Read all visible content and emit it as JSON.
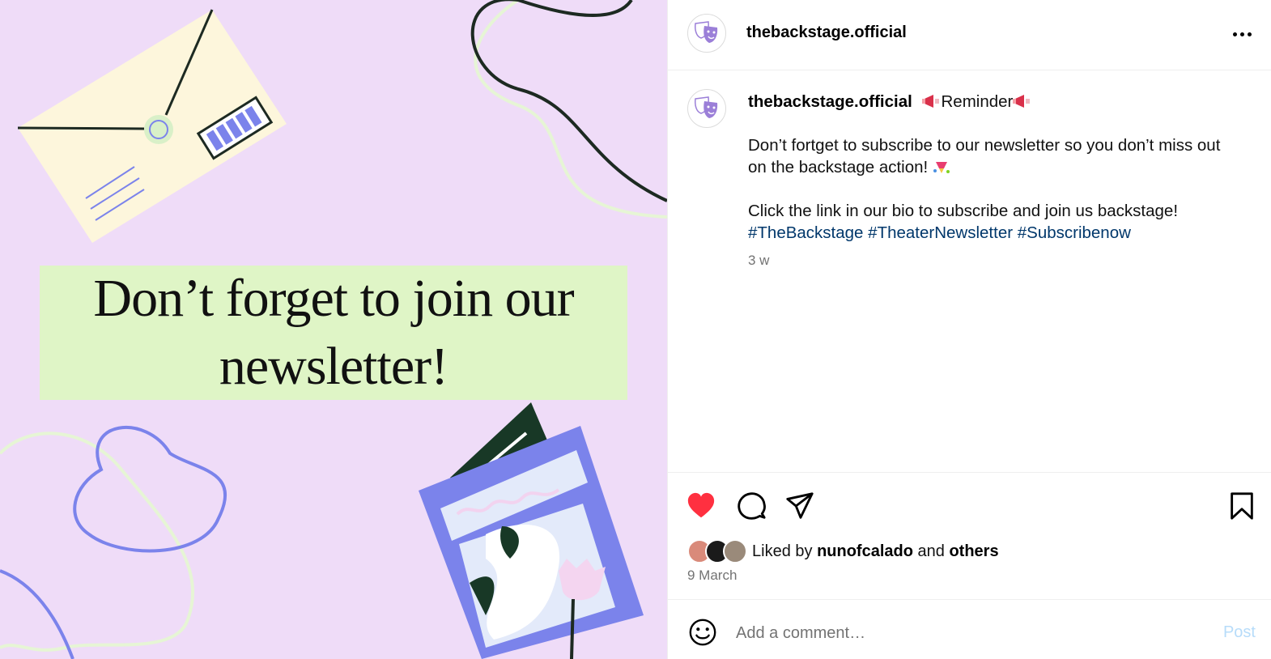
{
  "post": {
    "headline": "Don’t forget to join our newsletter!"
  },
  "header": {
    "username": "thebackstage.official",
    "avatar_icon": "theater-masks-icon",
    "more_icon": "more-options-icon"
  },
  "caption": {
    "username": "thebackstage.official",
    "title_word": "Reminder",
    "title_emoji": "megaphone-icon",
    "line1": "Don’t fortget to subscribe to our newsletter so you don’t miss out on the backstage action!",
    "line1_emoji": "confetti-icon",
    "line2": "Click the link in our bio to subscribe and join us backstage!",
    "hashtags": [
      "#TheBackstage",
      "#TheaterNewsletter",
      "#Subscribenow"
    ],
    "time_ago": "3 w"
  },
  "actions": {
    "like_icon": "heart-filled-icon",
    "comment_icon": "comment-icon",
    "share_icon": "paper-plane-icon",
    "save_icon": "bookmark-icon",
    "liked_by_prefix": "Liked by",
    "liked_by_user": "nunofcalado",
    "liked_by_and": "and",
    "liked_by_others": "others",
    "date": "9 March"
  },
  "comment": {
    "emoji_icon": "smiley-icon",
    "placeholder": "Add a comment…",
    "post_label": "Post"
  },
  "colors": {
    "image_bg": "#efdcf8",
    "headline_bg": "#dff5c6",
    "like_red": "#ff3040",
    "hashtag_blue": "#00376b",
    "post_disabled": "#b7dcfa",
    "accent_periwinkle": "#7b83eb"
  }
}
